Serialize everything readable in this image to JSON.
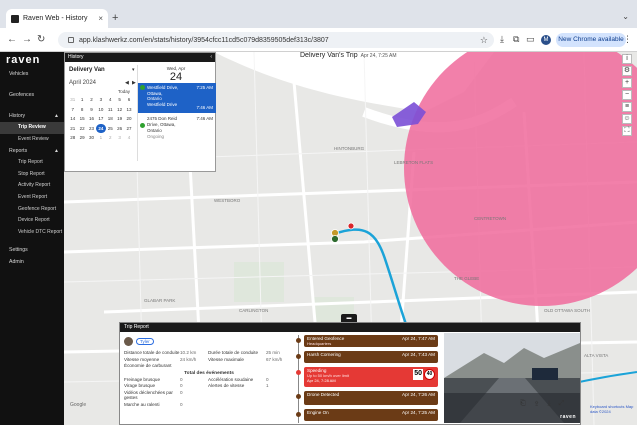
{
  "browser": {
    "tab_title": "Raven Web - History",
    "tab_close": "×",
    "new_tab": "+",
    "url": "app.klashwerkz.com/en/stats/history/3954cfcc11cd5c079d8359505def313c/3807",
    "profile_initial": "M",
    "update_button": "New Chrome available"
  },
  "sidebar": {
    "logo": "raven",
    "items": [
      {
        "label": "Vehicles"
      },
      {
        "label": "Geofences"
      },
      {
        "label": "History"
      },
      {
        "label": "Trip Review"
      },
      {
        "label": "Event Review"
      },
      {
        "label": "Reports"
      },
      {
        "label": "Trip Report"
      },
      {
        "label": "Stop Report"
      },
      {
        "label": "Activity Report"
      },
      {
        "label": "Event Report"
      },
      {
        "label": "Geofence Report"
      },
      {
        "label": "Device Report"
      },
      {
        "label": "Vehicle DTC Report"
      },
      {
        "label": "Settings"
      },
      {
        "label": "Admin"
      }
    ]
  },
  "history": {
    "header": "History",
    "vehicle": "Delivery Van",
    "month": "April 2024",
    "today": "Today",
    "day_header": "Wed, Apr",
    "day_number": "24",
    "cal_rows": [
      [
        "31",
        "1",
        "2",
        "3",
        "4",
        "5",
        "6"
      ],
      [
        "7",
        "8",
        "9",
        "10",
        "11",
        "12",
        "13"
      ],
      [
        "14",
        "15",
        "16",
        "17",
        "18",
        "19",
        "20"
      ],
      [
        "21",
        "22",
        "23",
        "24",
        "25",
        "26",
        "27"
      ],
      [
        "28",
        "29",
        "30",
        "1",
        "2",
        "3",
        "4"
      ]
    ],
    "selected_day": "24",
    "trips": [
      {
        "start_time": "7:25 AM",
        "lines": [
          "Westfield Drive,",
          "Ottawa,",
          "Ontario"
        ],
        "end_time": "7:46 AM",
        "end_label": "Westfield Drive"
      },
      {
        "start_time": "7:46 AM",
        "lines": [
          "2475 Don Reid",
          "Drive, Ottawa,",
          "Ontario",
          "Ongoing"
        ]
      }
    ]
  },
  "map": {
    "title": "Delivery Van's Trip",
    "title_date": "Apr 24, 7:25 AM",
    "google": "Google",
    "attribution": "Keyboard shortcuts  Map data ©2024",
    "labels": [
      "WESTBORO",
      "CARLINGTON",
      "CIVIC HOSPITAL",
      "HINTONBURG",
      "LEBRETON FLATS",
      "CENTRETOWN",
      "THE GLEBE",
      "OLD OTTAWA SOUTH",
      "GLABAR PARK",
      "LINCOLN HEIGHTS",
      "McKELLAR PARK",
      "ALTA VISTA"
    ],
    "geofence_color": "#f06a9b",
    "route_color": "#1ba3d8"
  },
  "trip_report": {
    "header": "Trip Report",
    "driver": "Tyler",
    "stats": [
      [
        "Distance totale de conduite",
        "10.2 km",
        "Durée totale de conduite",
        "25 min"
      ],
      [
        "Vitesse moyenne",
        "24 km/h",
        "Vitesse maximale",
        "67 km/h"
      ],
      [
        "Économie de carburant",
        "",
        "",
        ""
      ]
    ],
    "events_title": "Total des événements",
    "events": [
      [
        "Freinage brusque",
        "0",
        "Accélération soudaine",
        "0"
      ],
      [
        "Virage brusque",
        "0",
        "Alertes de vitesse",
        "1"
      ],
      [
        "Vidéos déclenchées par gestes",
        "0",
        "",
        ""
      ],
      [
        "Marche au ralenti",
        "0",
        "",
        ""
      ]
    ],
    "timeline": [
      {
        "label": "Entered Geofence",
        "sub": "Headquarters",
        "time": "Apr 24, 7:47 AM",
        "color": "#6b3b16"
      },
      {
        "label": "Harsh Cornering",
        "sub": "",
        "time": "Apr 24, 7:43 AM",
        "color": "#6b3b16"
      },
      {
        "label": "Speeding",
        "sub": "Up to 50 km/h over limit",
        "time": "Apr 24, 7:28 AM",
        "color": "#e53935",
        "speed": "50",
        "limit": "40"
      },
      {
        "label": "Drone Detected",
        "sub": "",
        "time": "Apr 24, 7:26 AM",
        "color": "#6b3b16"
      },
      {
        "label": "Engine On",
        "sub": "",
        "time": "Apr 24, 7:25 AM",
        "color": "#6b3b16"
      }
    ],
    "video_brand": "raven"
  }
}
